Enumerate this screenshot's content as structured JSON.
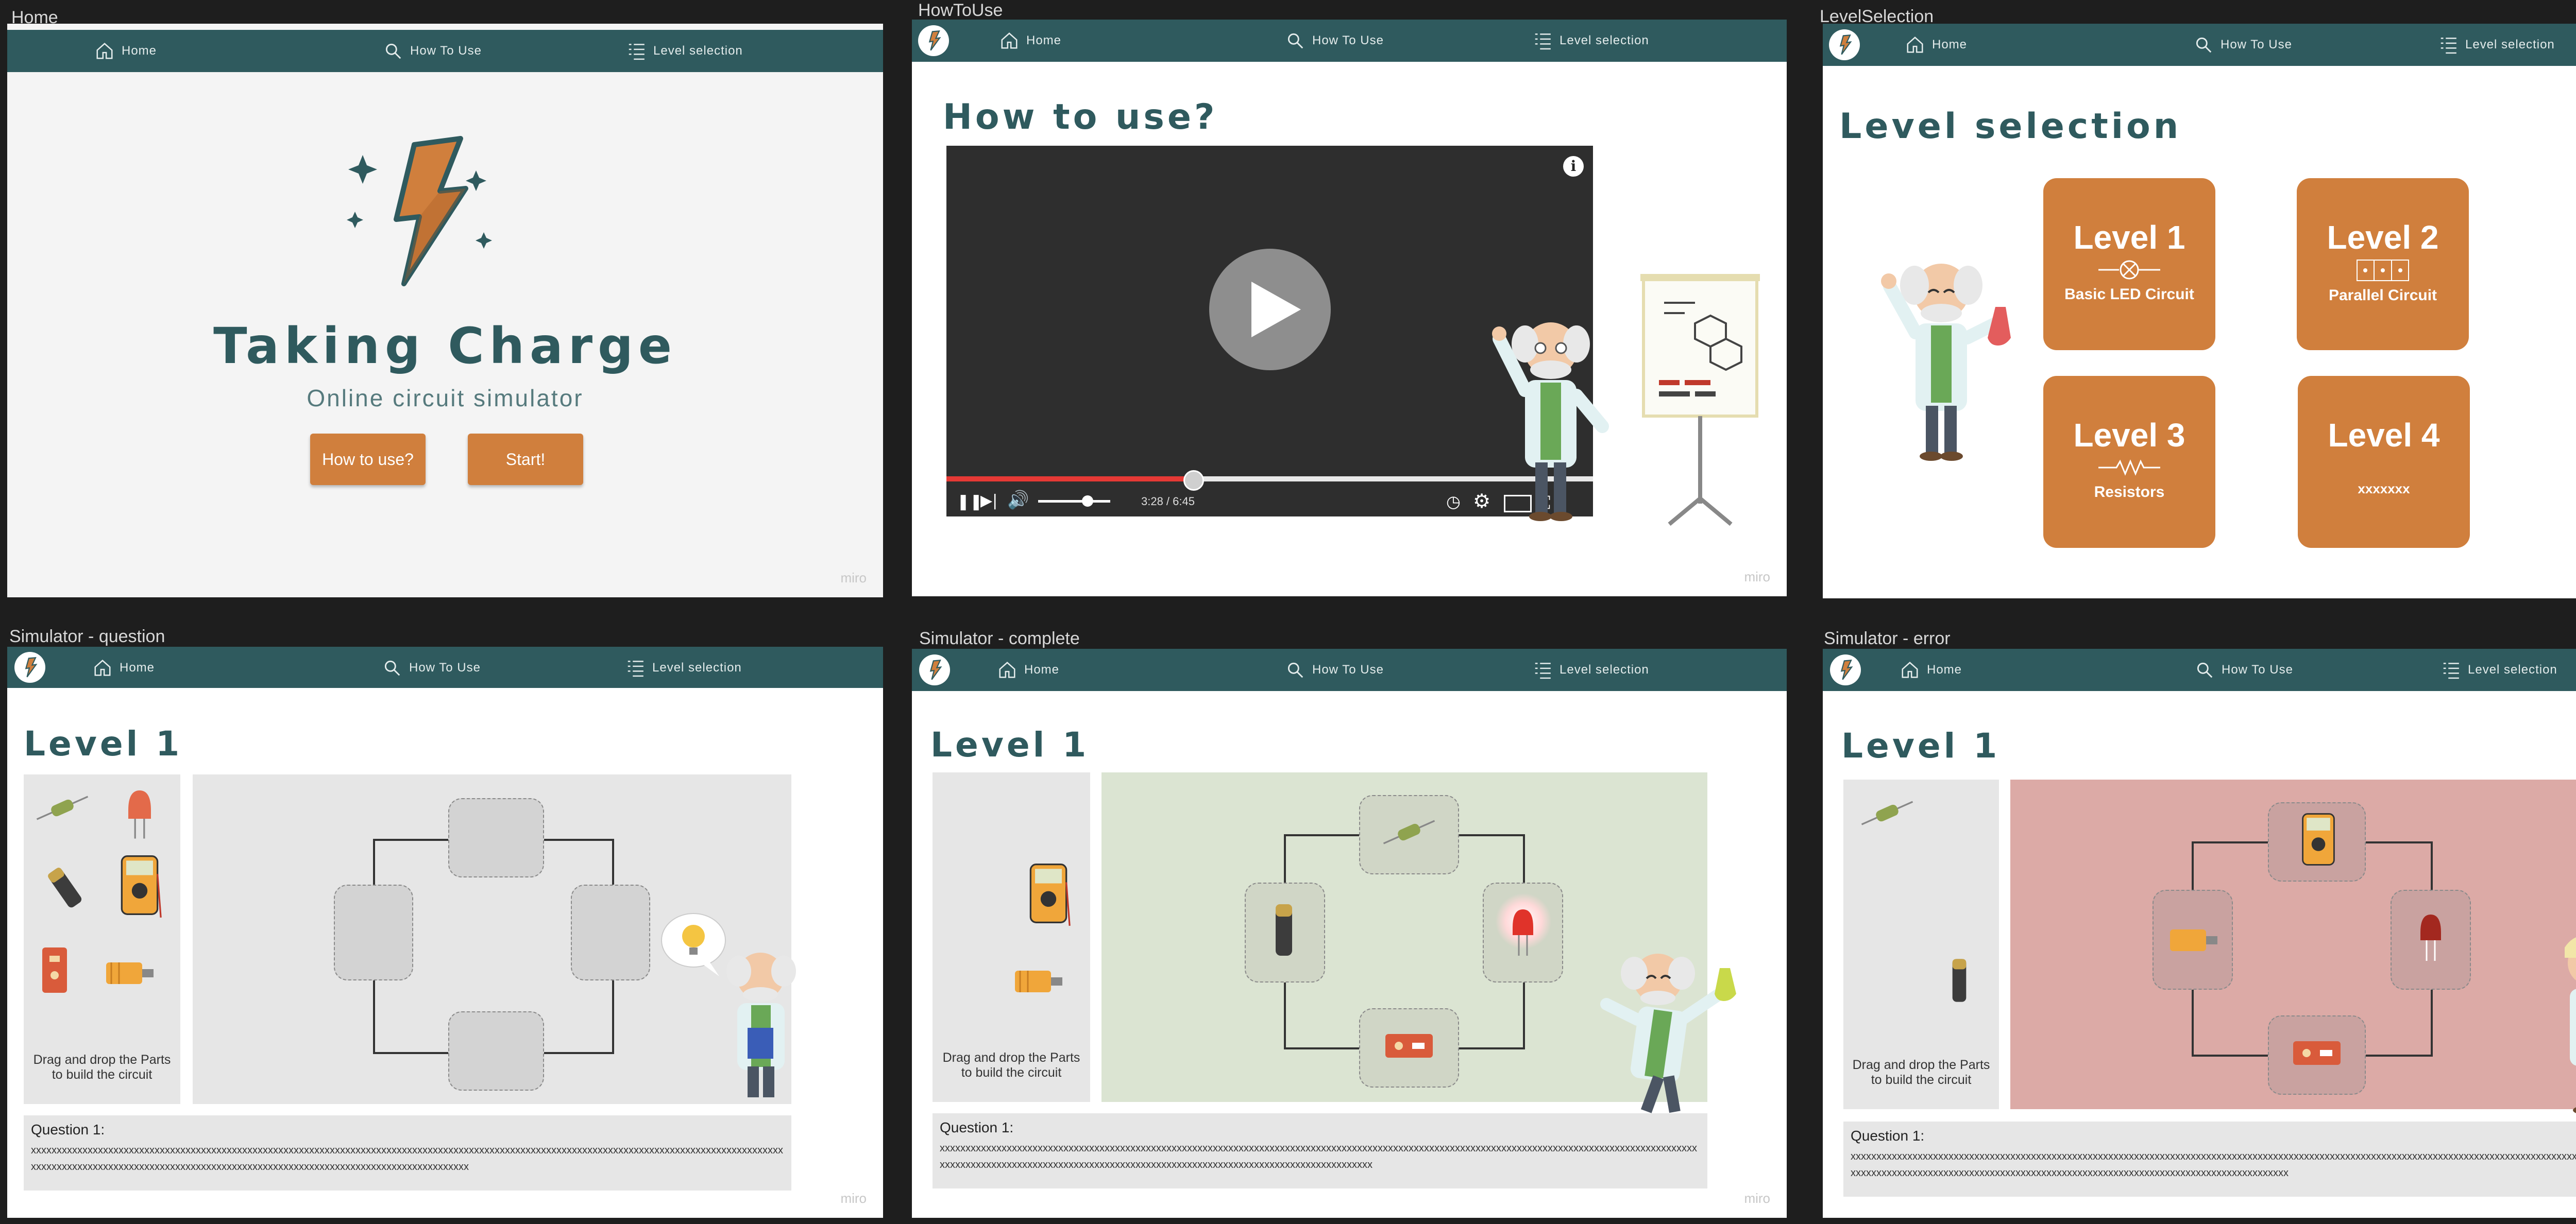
{
  "frames": {
    "home": "Home",
    "howto": "HowToUse",
    "levels": "LevelSelection",
    "sim_q": "Simulator - question",
    "sim_c": "Simulator - complete",
    "sim_e": "Simulator - error"
  },
  "nav": {
    "home": "Home",
    "how_to_use": "How To Use",
    "level_selection": "Level selection"
  },
  "home": {
    "title": "Taking Charge",
    "subtitle": "Online circuit simulator",
    "how_button": "How to use?",
    "start_button": "Start!"
  },
  "howto": {
    "title": "How to use?",
    "time": "3:28 / 6:45",
    "progress": 0.38
  },
  "levels": {
    "title": "Level selection",
    "cards": [
      {
        "level": "Level 1",
        "sub": "Basic LED Circuit"
      },
      {
        "level": "Level 2",
        "sub": "Parallel Circuit"
      },
      {
        "level": "Level 3",
        "sub": "Resistors"
      },
      {
        "level": "Level 4",
        "sub": "xxxxxxx"
      }
    ]
  },
  "sim": {
    "title": "Level 1",
    "drag_hint": "Drag and drop the Parts to build the circuit",
    "question_label": "Question 1:",
    "question_text": "xxxxxxxxxxxxxxxxxxxxxxxxxxxxxxxxxxxxxxxxxxxxxxxxxxxxxxxxxxxxxxxxxxxxxxxxxxxxxxxxxxxxxxxxxxxxxxxxxxxxxxxxxxxxxxxxxxxxxxxxxxxxxxxxxxxxxxxxxxxxxxxxxxxxxxxxxxxxxxxxxxxxxxxxxxxxxxxxxxxxxxxxxxxxxxxxxxxxxxxxxxxxxxxxxxxxxxxxxxxxxxxxxxxxxxx"
  },
  "watermark": "miro",
  "colors": {
    "navbar": "#2f5a5e",
    "accent": "#d07f3d",
    "success_bg": "#dbe4d2",
    "error_bg": "#dcaaa6"
  }
}
